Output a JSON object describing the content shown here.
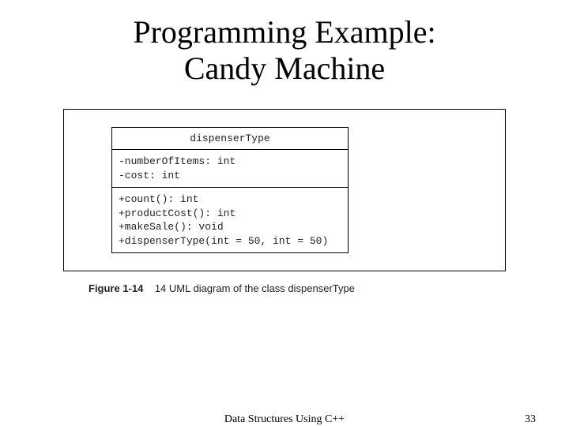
{
  "title_line1": "Programming Example:",
  "title_line2": "Candy Machine",
  "uml": {
    "class_name": "dispenserType",
    "attributes": [
      "-numberOfItems: int",
      "-cost: int"
    ],
    "operations": [
      "+count(): int",
      "+productCost(): int",
      "+makeSale(): void",
      "+dispenserType(int = 50, int = 50)"
    ]
  },
  "caption": {
    "label": "Figure 1-14",
    "text": "14 UML diagram of the class dispenserType"
  },
  "footer": {
    "center": "Data Structures Using C++",
    "page": "33"
  }
}
